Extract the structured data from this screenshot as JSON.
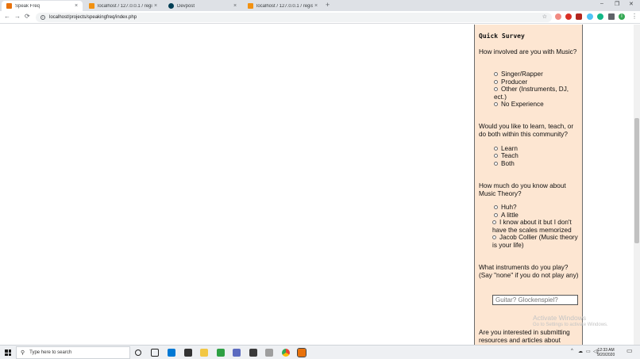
{
  "browser": {
    "tabs": [
      {
        "label": "Speak Freq",
        "active": true,
        "favicon_color": "#e8710a"
      },
      {
        "label": "localhost / 127.0.0.1 / registry / u",
        "active": false,
        "favicon_color": "#f29111"
      },
      {
        "label": "Devpost",
        "active": false,
        "favicon_color": "#003e54"
      },
      {
        "label": "localhost / 127.0.0.1 / registry / u",
        "active": false,
        "favicon_color": "#f29111"
      }
    ],
    "tab_close": "×",
    "new_tab": "+",
    "window_controls": {
      "minimize": "–",
      "maximize": "❐",
      "close": "✕"
    },
    "nav": {
      "back": "←",
      "forward": "→",
      "reload": "⟳"
    },
    "address": "localhost/projects/speakingfreq/index.php",
    "star": "☆",
    "profile_initial": "I"
  },
  "survey": {
    "title": "Quick Survey",
    "q1": {
      "text": "How involved are you with Music?",
      "options": [
        "Singer/Rapper",
        "Producer",
        "Other (Instruments, DJ, ect.)",
        "No Experience"
      ]
    },
    "q2": {
      "text": "Would you like to learn, teach, or do both within this community?",
      "options": [
        "Learn",
        "Teach",
        "Both"
      ]
    },
    "q3": {
      "text": "How much do you know about Music Theory?",
      "options": [
        "Huh?",
        "A little",
        "I know about it but I don't have the scales memorized",
        "Jacob Collier (Music theory is your life)"
      ]
    },
    "q4": {
      "text": "What instruments do you play? (Say \"none\" if you do not play any)",
      "placeholder": "Guitar? Glockenspiel?"
    },
    "q5": {
      "text": "Are you interested in submitting resources and articles about"
    }
  },
  "watermark": {
    "line1": "Activate Windows",
    "line2": "Go to Settings to activate Windows."
  },
  "taskbar": {
    "search_placeholder": "Type here to search",
    "time": "12:33 AM",
    "date": "9/20/2020"
  },
  "colors": {
    "panel_bg": "#fde6d2",
    "tabstrip_bg": "#dee1e6"
  }
}
